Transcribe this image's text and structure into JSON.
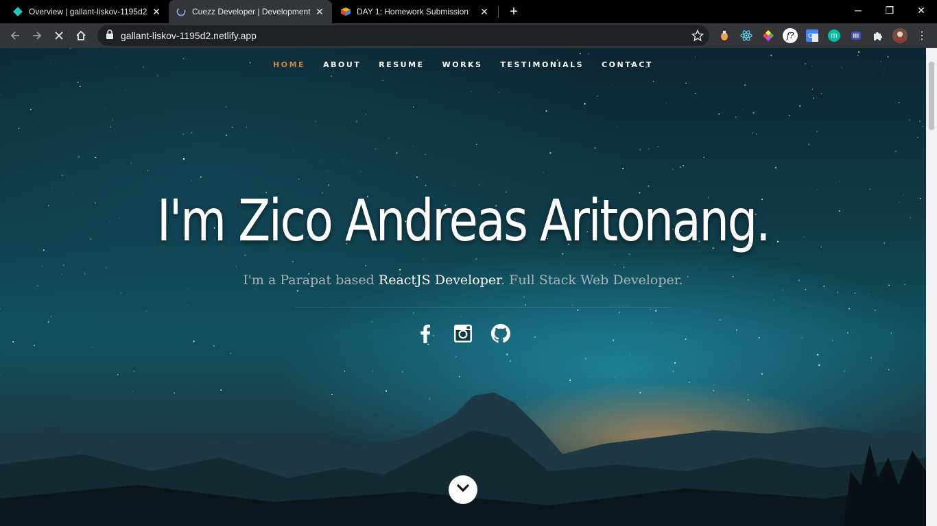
{
  "browser": {
    "tabs": [
      {
        "title": "Overview | gallant-liskov-1195d2",
        "icon": "netlify-diamond-icon"
      },
      {
        "title": "Cuezz Developer | Development",
        "icon": "loading-spinner-icon"
      },
      {
        "title": "DAY 1: Homework Submission",
        "icon": "colored-cube-icon"
      }
    ],
    "url": "gallant-liskov-1195d2.netlify.app"
  },
  "page": {
    "nav": [
      "HOME",
      "ABOUT",
      "RESUME",
      "WORKS",
      "TESTIMONIALS",
      "CONTACT"
    ],
    "headline": "I'm Zico Andreas Aritonang.",
    "intro_prefix": "I'm a Parapat based ",
    "intro_highlight": "ReactJS Developer",
    "intro_suffix": ". Full Stack Web Developer.",
    "social_icons": [
      "facebook-icon",
      "instagram-icon",
      "github-icon"
    ]
  },
  "colors": {
    "nav_active": "#d4873f",
    "chrome_dark": "#000000",
    "toolbar": "#35363a"
  }
}
